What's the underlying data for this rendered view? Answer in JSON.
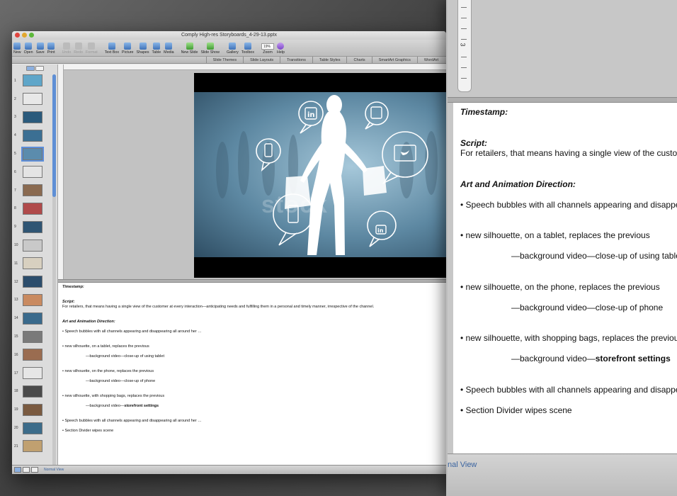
{
  "window": {
    "title": "Comply High-res Storyboards_4-29-13.pptx"
  },
  "toolbar": {
    "buttons": [
      "New",
      "Open",
      "Save",
      "Print",
      "Undo",
      "Redo",
      "Format",
      "Text Box",
      "Picture",
      "Shapes",
      "Table",
      "Media",
      "New Slide",
      "Slide Show",
      "Gallery",
      "Toolbox",
      "Zoom",
      "Help"
    ],
    "zoom_value": "19%"
  },
  "ribbon": {
    "tabs": [
      "Slide Themes",
      "Slide Layouts",
      "Transitions",
      "Table Styles",
      "Charts",
      "SmartArt Graphics",
      "WordArt"
    ]
  },
  "thumbnails": {
    "numbers": [
      "1",
      "2",
      "3",
      "4",
      "5",
      "6",
      "7",
      "8",
      "9",
      "10",
      "11",
      "12",
      "13",
      "14",
      "15",
      "16",
      "17",
      "18",
      "19",
      "20",
      "21"
    ],
    "selected": "5"
  },
  "slide": {
    "watermark": "stock"
  },
  "notes": {
    "timestamp_label": "Timestamp:",
    "script_label": "Script:",
    "script_text": "For retailers, that means having a single view of the customer at every interaction—anticipating needs and fulfilling them in a personal and timely manner, irrespective of the channel.",
    "direction_label": "Art and Animation Direction:",
    "line1": "• Speech bubbles with all channels appearing and disappearing all around her …",
    "line2": "• new silhouette, on a tablet, replaces the previous",
    "line2b": "—background video—close-up of using tablet",
    "line3": "• new silhouette, on the phone, replaces the previous",
    "line3b": "—background video—close-up of phone",
    "line4": "• new silhouette, with shopping bags, replaces the previous",
    "line4b_pre": "—background video—",
    "line4b_bold": "storefront settings",
    "line5": "• Speech bubbles with all channels appearing and disappearing all around her …",
    "line6": "• Section Divider wipes scene"
  },
  "status": {
    "view_label": "Normal View"
  },
  "zoomed": {
    "ruler_mark": "3",
    "timestamp_label": "Timestamp:",
    "script_label": "Script:",
    "script_text": "For retailers, that means having a single view of the custo",
    "direction_label": "Art and Animation Direction:",
    "line1": "• Speech bubbles with all channels appearing and disappe",
    "line2": "• new silhouette, on a tablet, replaces the previous",
    "line2b": "—background video—close-up of using table",
    "line3": "• new silhouette, on the phone, replaces the previous",
    "line3b": "—background video—close-up of phone",
    "line4": "• new silhouette, with shopping bags, replaces the previou",
    "line4b_pre": "—background video—",
    "line4b_bold": "storefront settings",
    "line5": "• Speech bubbles with all channels appearing and disappe",
    "line6": "• Section Divider wipes scene",
    "status_label": "nal View"
  },
  "colors": {
    "selection": "#5b8edb",
    "link_blue": "#3b64a0",
    "slide_bg": "#000000"
  }
}
